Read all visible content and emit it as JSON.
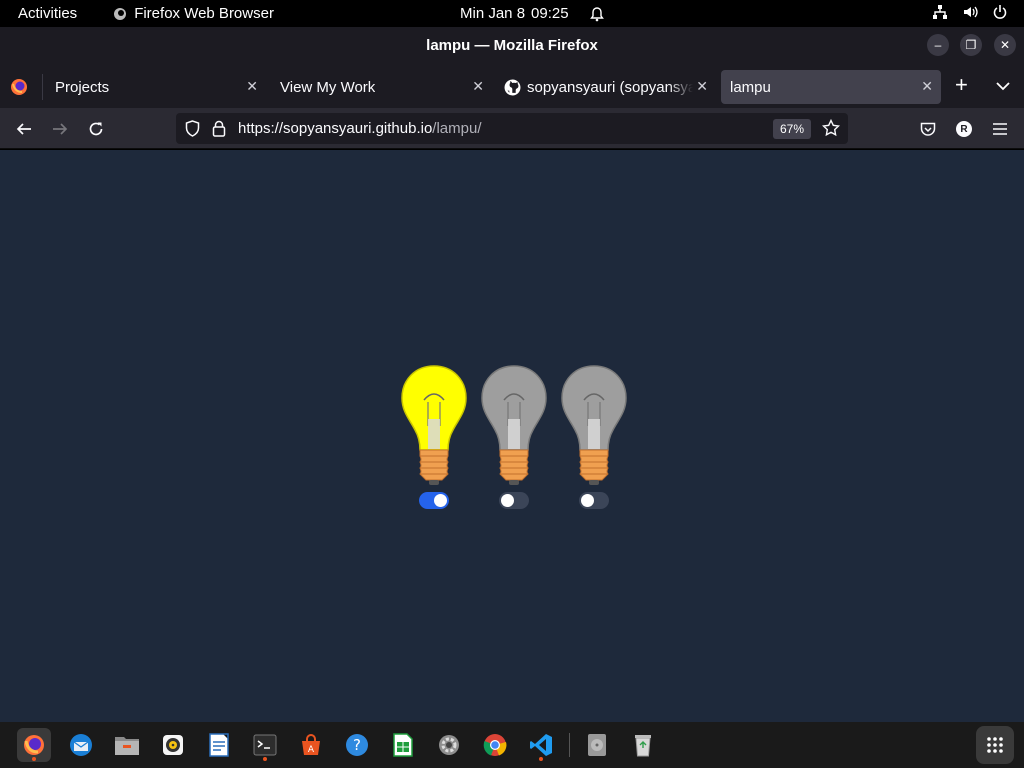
{
  "topbar": {
    "activities": "Activities",
    "app_name": "Firefox Web Browser",
    "date": "Min Jan 8",
    "time": "09:25"
  },
  "window": {
    "title": "lampu — Mozilla Firefox"
  },
  "tabs": [
    {
      "label": "Projects",
      "active": false
    },
    {
      "label": "View My Work",
      "active": false
    },
    {
      "label": "sopyansyauri (sopyansyauri)",
      "active": false
    },
    {
      "label": "lampu",
      "active": true
    }
  ],
  "navbar": {
    "url_host": "https://sopyansyauri.github.io",
    "url_path": "/lampu/",
    "zoom": "67%",
    "account_initial": "R"
  },
  "page": {
    "background": "#1e293b",
    "lamps": [
      {
        "on": true,
        "color": "#ffff00"
      },
      {
        "on": false,
        "color": "#9e9e9e"
      },
      {
        "on": false,
        "color": "#9e9e9e"
      }
    ]
  },
  "dock": {
    "apps": [
      "firefox-icon",
      "thunderbird-icon",
      "files-icon",
      "rhythmbox-icon",
      "writer-icon",
      "terminal-icon",
      "software-icon",
      "help-icon",
      "calc-icon",
      "settings-icon",
      "chrome-icon",
      "vscode-icon",
      "disk-icon",
      "trash-icon",
      "app-grid-icon"
    ]
  }
}
